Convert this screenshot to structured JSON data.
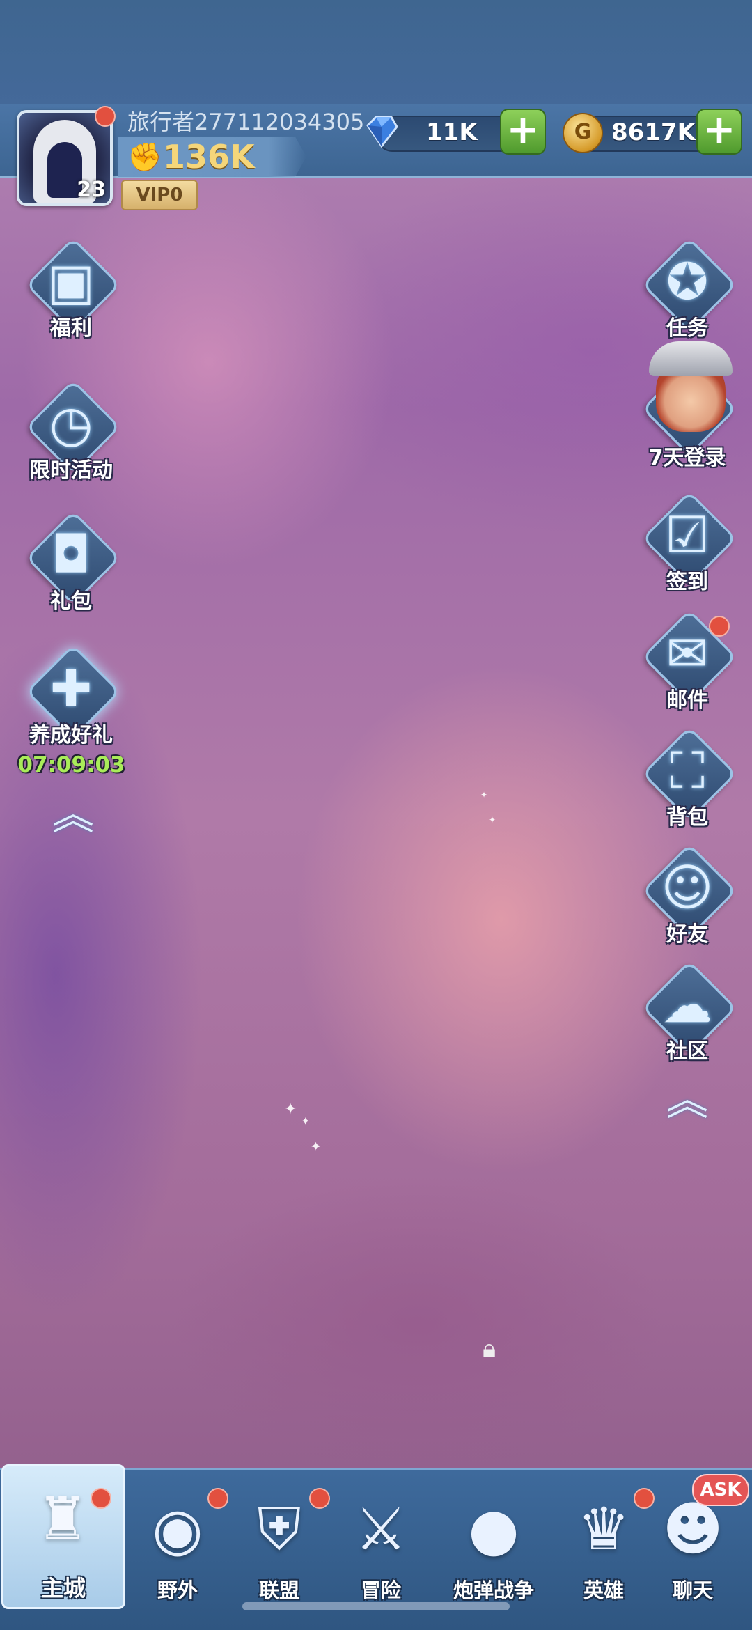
{
  "player": {
    "name": "旅行者277112034305",
    "level": "23",
    "power": "136K",
    "vip": "VIP0"
  },
  "currency": {
    "gems": "11K",
    "gold": "8617K",
    "gold_symbol": "G",
    "plus": "+"
  },
  "left_menu": [
    {
      "label": "福利",
      "icon": "treasure-chest-icon"
    },
    {
      "label": "限时活动",
      "icon": "gift-clock-icon"
    },
    {
      "label": "礼包",
      "icon": "chest-icon"
    },
    {
      "label": "养成好礼",
      "icon": "gift-icon",
      "timer": "07:09:03"
    }
  ],
  "right_menu": [
    {
      "label": "任务",
      "icon": "compass-icon"
    },
    {
      "label": "7天登录",
      "icon": "hero-portrait-icon"
    },
    {
      "label": "签到",
      "icon": "calendar-check-icon"
    },
    {
      "label": "邮件",
      "icon": "envelope-icon"
    },
    {
      "label": "背包",
      "icon": "backpack-icon"
    },
    {
      "label": "好友",
      "icon": "friends-icon"
    },
    {
      "label": "社区",
      "icon": "chat-bubbles-icon"
    }
  ],
  "tabs": [
    {
      "label": "主城",
      "icon": "castle-icon",
      "active": true
    },
    {
      "label": "野外",
      "icon": "portal-icon"
    },
    {
      "label": "联盟",
      "icon": "shield-star-icon"
    },
    {
      "label": "冒险",
      "icon": "sword-wings-icon"
    },
    {
      "label": "炮弹战争",
      "icon": "cannonball-icon"
    },
    {
      "label": "英雄",
      "icon": "helmet-icon"
    },
    {
      "label": "聊天",
      "icon": "chat-face-icon"
    }
  ],
  "ask_badge": "ASK",
  "colors": {
    "header": "#4b75a6",
    "tabbar": "#3e6a9c",
    "notification": "#e2503f",
    "timer": "#a9ec59",
    "power": "#f5d67a"
  }
}
